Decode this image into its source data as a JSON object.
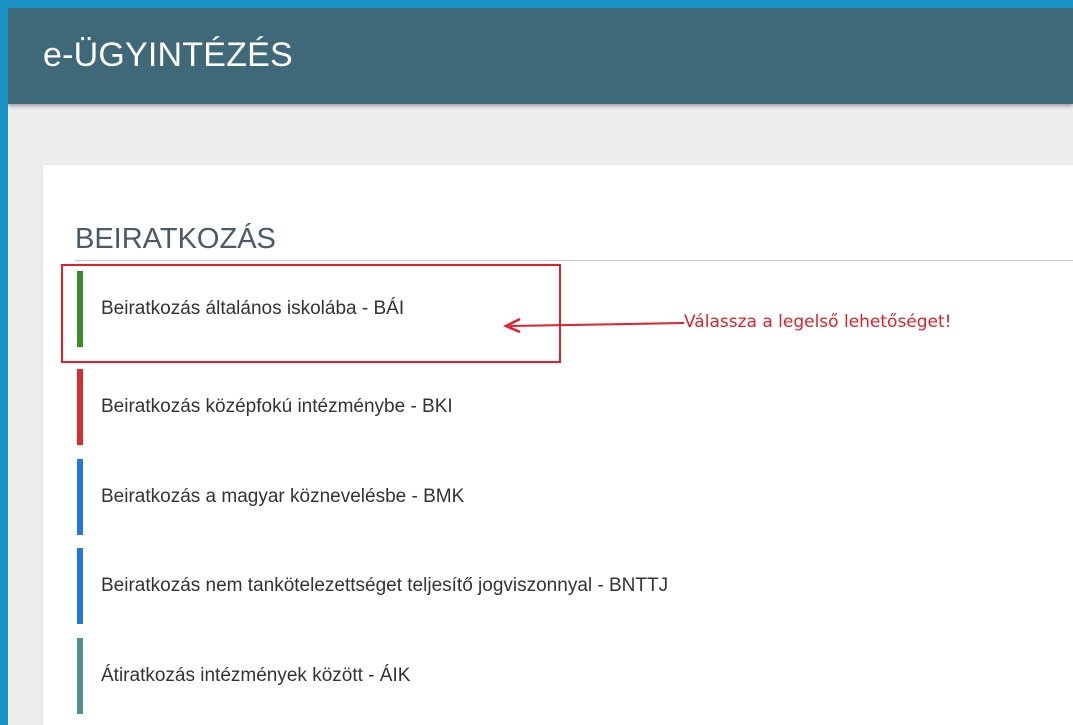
{
  "app": {
    "title": "e-ÜGYINTÉZÉS"
  },
  "section": {
    "title": "BEIRATKOZÁS"
  },
  "items": [
    {
      "label": "Beiratkozás általános iskolába - BÁI",
      "color": "#3a8c28"
    },
    {
      "label": "Beiratkozás középfokú intézménybe - BKI",
      "color": "#d32f2f"
    },
    {
      "label": "Beiratkozás a magyar köznevelésbe - BMK",
      "color": "#1e78e0"
    },
    {
      "label": "Beiratkozás nem tankötelezettséget teljesítő jogviszonnyal - BNTTJ",
      "color": "#1e78e0"
    },
    {
      "label": "Átiratkozás intézmények között - ÁIK",
      "color": "#4f9088"
    }
  ],
  "annotation": {
    "text": "Válassza a legelső lehetőséget!",
    "color": "#e0202a"
  },
  "colors": {
    "outer_background": "#1b93c6",
    "header_background": "#3f6879",
    "page_background": "#eeeeee",
    "card_background": "#ffffff"
  }
}
